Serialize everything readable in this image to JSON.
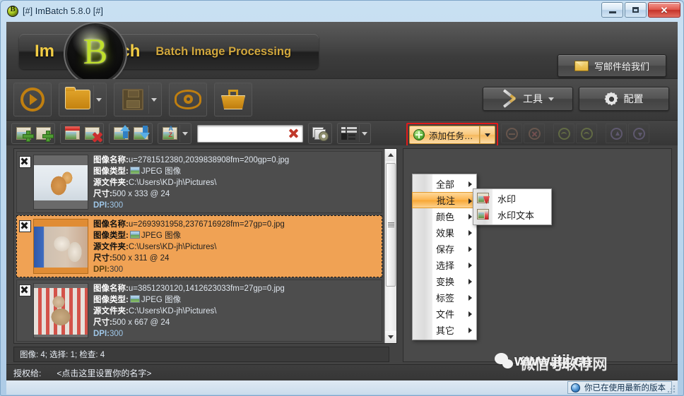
{
  "window": {
    "title": "[#] ImBatch 5.8.0 [#]",
    "app_icon": "imbatch-b-icon",
    "minimize_label": "",
    "maximize_label": "",
    "close_label": "✕"
  },
  "header": {
    "logo_im": "Im",
    "logo_orb": "B",
    "logo_atch": "atch",
    "tagline": "Batch Image Processing",
    "mail_button": "写邮件给我们"
  },
  "toolbar_main": {
    "run_icon": "play-circle-icon",
    "open_icon": "folder-icon",
    "save_icon": "save-disk-icon",
    "preview_icon": "eye-icon",
    "basket_icon": "basket-icon",
    "tools_label": "工具",
    "config_label": "配置"
  },
  "toolbar_second": {
    "add_image_icon": "add-image-icon",
    "add_folder_icon": "add-folder-icon",
    "remove_icon": "remove-image-icon",
    "clear_icon": "delete-image-icon",
    "move_up_icon": "move-image-up-icon",
    "move_down_icon": "move-image-down-icon",
    "sort_icon": "sort-az-icon",
    "search_value": "",
    "search_placeholder": "",
    "clear_search_icon": "clear-x-icon",
    "preview_settings_icon": "preview-settings-icon",
    "view_mode_icon": "view-mode-icon",
    "add_task_label": "添加任务…",
    "add_task_icon": "green-plus-icon"
  },
  "menu": {
    "items": [
      {
        "label": "全部",
        "highlighted": false
      },
      {
        "label": "批注",
        "highlighted": true
      },
      {
        "label": "颜色",
        "highlighted": false
      },
      {
        "label": "效果",
        "highlighted": false
      },
      {
        "label": "保存",
        "highlighted": false
      },
      {
        "label": "选择",
        "highlighted": false
      },
      {
        "label": "变换",
        "highlighted": false
      },
      {
        "label": "标签",
        "highlighted": false
      },
      {
        "label": "文件",
        "highlighted": false
      },
      {
        "label": "其它",
        "highlighted": false
      }
    ],
    "submenu": [
      {
        "label": "水印",
        "icon": "watermark-icon"
      },
      {
        "label": "水印文本",
        "icon": "watermark-text-icon"
      }
    ]
  },
  "list": {
    "labels": {
      "name": "图像名称:",
      "type": "图像类型:",
      "folder": "源文件夹:",
      "size": "尺寸:",
      "dpi": "DPI:"
    },
    "items": [
      {
        "checked": true,
        "selected": false,
        "name": "u=2781512380,2039838908fm=200gp=0.jpg",
        "type": "JPEG 图像",
        "folder": "C:\\Users\\KD-jh\\Pictures\\",
        "size": "500 x 333 @ 24",
        "dpi": "300"
      },
      {
        "checked": true,
        "selected": true,
        "name": "u=2693931958,2376716928fm=27gp=0.jpg",
        "type": "JPEG 图像",
        "folder": "C:\\Users\\KD-jh\\Pictures\\",
        "size": "500 x 311 @ 24",
        "dpi": "300"
      },
      {
        "checked": true,
        "selected": false,
        "name": "u=3851230120,1412623033fm=27gp=0.jpg",
        "type": "JPEG 图像",
        "folder": "C:\\Users\\KD-jh\\Pictures\\",
        "size": "500 x 667 @ 24",
        "dpi": "300"
      }
    ],
    "summary": "图像: 4; 选择: 1; 检查: 4"
  },
  "bottom": {
    "license_label": "授权给:",
    "license_value": "<点击这里设置你的名字>",
    "version_status": "你已在使用最新的版本",
    "version_icon": "info-globe-icon"
  },
  "watermark": {
    "text1": "www.jtjj.cn",
    "text2": "微信号软荐网",
    "icon": "wechat-icon"
  },
  "colors": {
    "accent_orange": "#f0a254",
    "highlight_red": "#e21b1b",
    "logo_yellow": "#f2cd45",
    "orb_green": "#bfe02c",
    "panel_dark": "#434343"
  }
}
